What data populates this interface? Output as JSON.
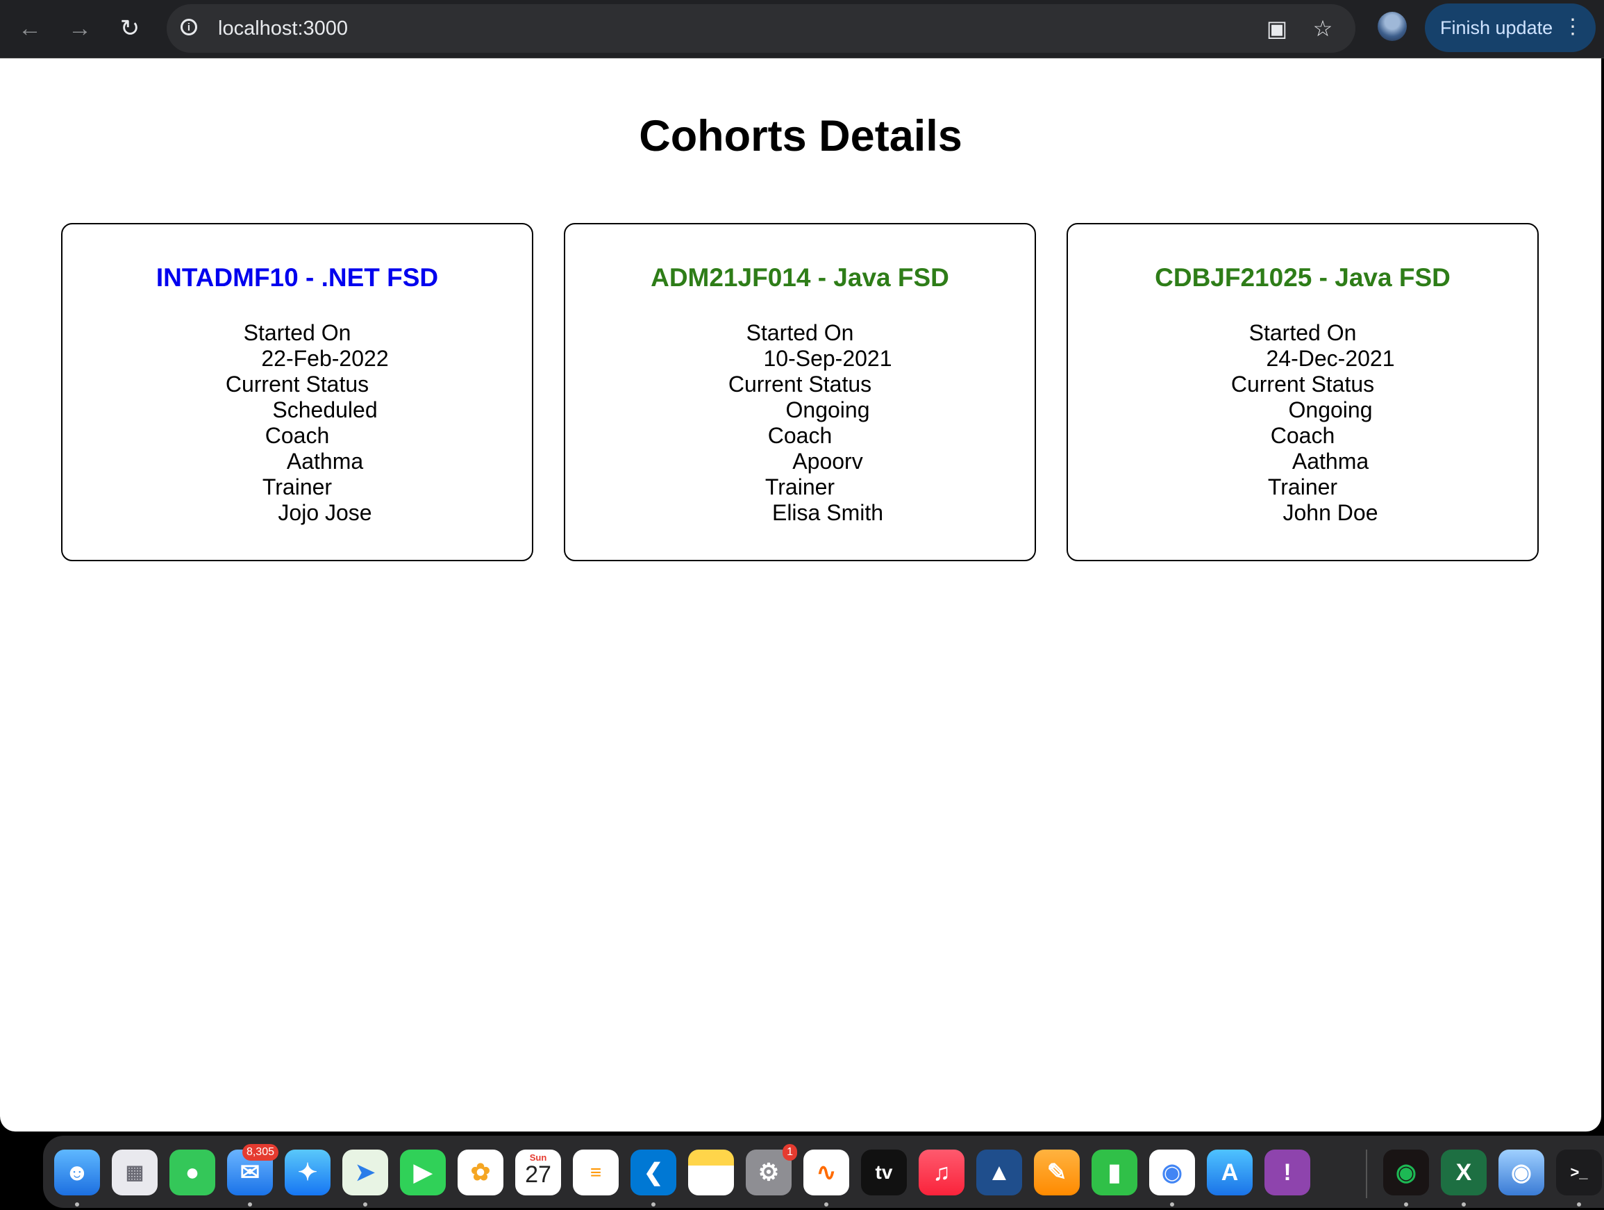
{
  "browser": {
    "url": "localhost:3000",
    "update_label": "Finish update"
  },
  "page": {
    "title": "Cohorts Details"
  },
  "cohorts": [
    {
      "title": "INTADMF10 - .NET FSD",
      "title_color": "#0000ee",
      "started_on_label": "Started On",
      "started_on": "22-Feb-2022",
      "status_label": "Current Status",
      "status": "Scheduled",
      "coach_label": "Coach",
      "coach": "Aathma",
      "trainer_label": "Trainer",
      "trainer": "Jojo Jose"
    },
    {
      "title": "ADM21JF014 - Java FSD",
      "title_color": "#2e7d18",
      "started_on_label": "Started On",
      "started_on": "10-Sep-2021",
      "status_label": "Current Status",
      "status": "Ongoing",
      "coach_label": "Coach",
      "coach": "Apoorv",
      "trainer_label": "Trainer",
      "trainer": "Elisa Smith"
    },
    {
      "title": "CDBJF21025 - Java FSD",
      "title_color": "#2e7d18",
      "started_on_label": "Started On",
      "started_on": "24-Dec-2021",
      "status_label": "Current Status",
      "status": "Ongoing",
      "coach_label": "Coach",
      "coach": "Aathma",
      "trainer_label": "Trainer",
      "trainer": "John Doe"
    }
  ],
  "dock": {
    "mail_badge": "8,305",
    "settings_badge": "1",
    "calendar_day": "Sun",
    "calendar_date": "27",
    "apple_tv_label": "tv"
  },
  "colors": {
    "net_title": "#0000ee",
    "java_title": "#2e7d18",
    "update_button": "#16416b"
  }
}
